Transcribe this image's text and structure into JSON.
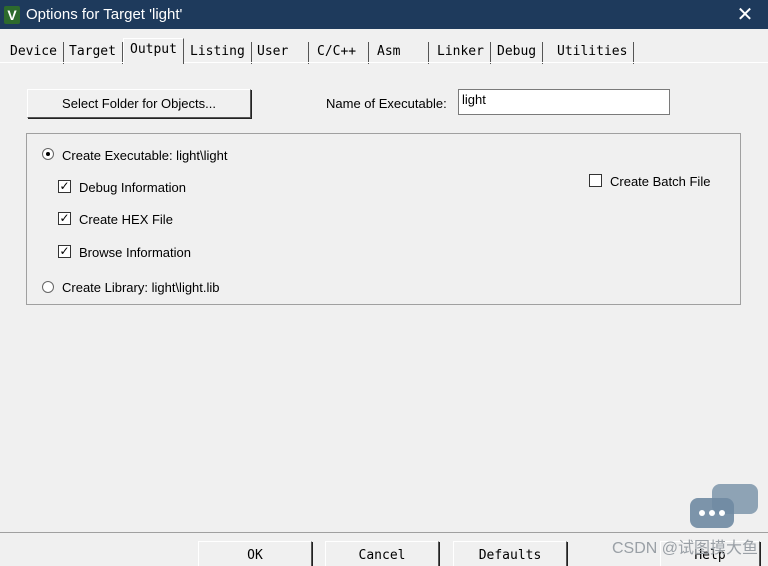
{
  "window": {
    "title": "Options for Target 'light'",
    "app_icon": "V",
    "close_glyph": "✕"
  },
  "tabs": [
    {
      "label": "Device"
    },
    {
      "label": "Target"
    },
    {
      "label": "Output"
    },
    {
      "label": "Listing"
    },
    {
      "label": "User"
    },
    {
      "label": "C/C++"
    },
    {
      "label": "Asm"
    },
    {
      "label": "Linker"
    },
    {
      "label": "Debug"
    },
    {
      "label": "Utilities"
    }
  ],
  "output": {
    "select_folder_label": "Select Folder for Objects...",
    "name_exec_label": "Name of Executable:",
    "name_exec_value": "light",
    "create_exec_label": "Create Executable:  light\\light",
    "debug_info_label": "Debug Information",
    "create_hex_label": "Create HEX File",
    "browse_info_label": "Browse Information",
    "create_lib_label": "Create Library:  light\\light.lib",
    "create_batch_label": "Create Batch File"
  },
  "footer": {
    "ok": "OK",
    "cancel": "Cancel",
    "defaults": "Defaults",
    "help": "Help"
  },
  "watermark": "CSDN @试图摸大鱼",
  "colors": {
    "titlebar": "#1e3a5c",
    "dialog_bg": "#f0f0f0"
  }
}
